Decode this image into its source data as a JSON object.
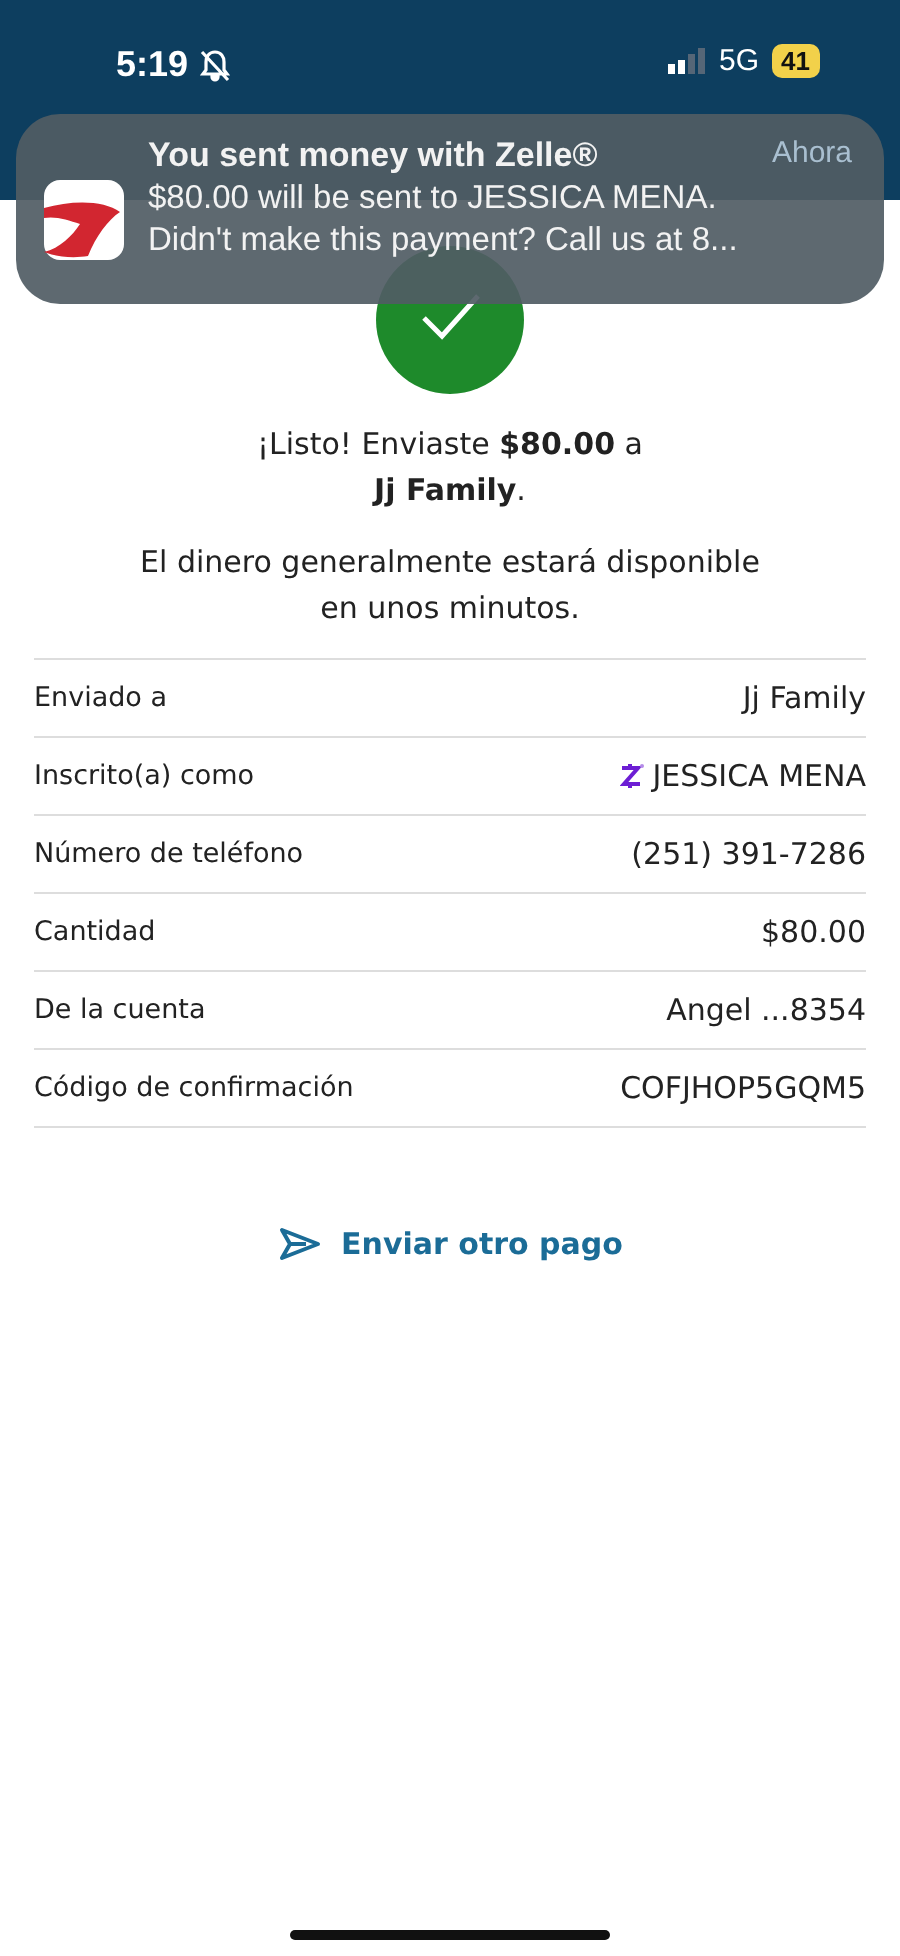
{
  "status_bar": {
    "time": "5:19",
    "network": "5G",
    "battery": "41"
  },
  "notification": {
    "title": "You sent money with Zelle®",
    "time": "Ahora",
    "body": "$80.00 will be sent to JESSICA MENA.",
    "body2": "Didn't make this payment? Call us at 8..."
  },
  "confirmation": {
    "message": "¡Listo! Enviaste **$80.00** a",
    "message2": "**Jj Family**.",
    "note": "El dinero generalmente estará disponible",
    "note2": "en unos minutos."
  },
  "details": [
    {
      "kind": "plain",
      "label": "Enviado a",
      "value": "Jj Family"
    },
    {
      "kind": "zelle",
      "label": "Inscrito(a) como",
      "value": "JESSICA MENA"
    },
    {
      "kind": "plain",
      "label": "Número de teléfono",
      "value": "(251) 391-7286"
    },
    {
      "kind": "plain",
      "label": "Cantidad",
      "value": "$80.00"
    },
    {
      "kind": "plain",
      "label": "De la cuenta",
      "value": "Angel ...8354"
    },
    {
      "kind": "plain",
      "label": "Código de confirmación",
      "value": "COFJHOP5GQM5"
    }
  ],
  "action": {
    "label": "Enviar otro pago"
  }
}
